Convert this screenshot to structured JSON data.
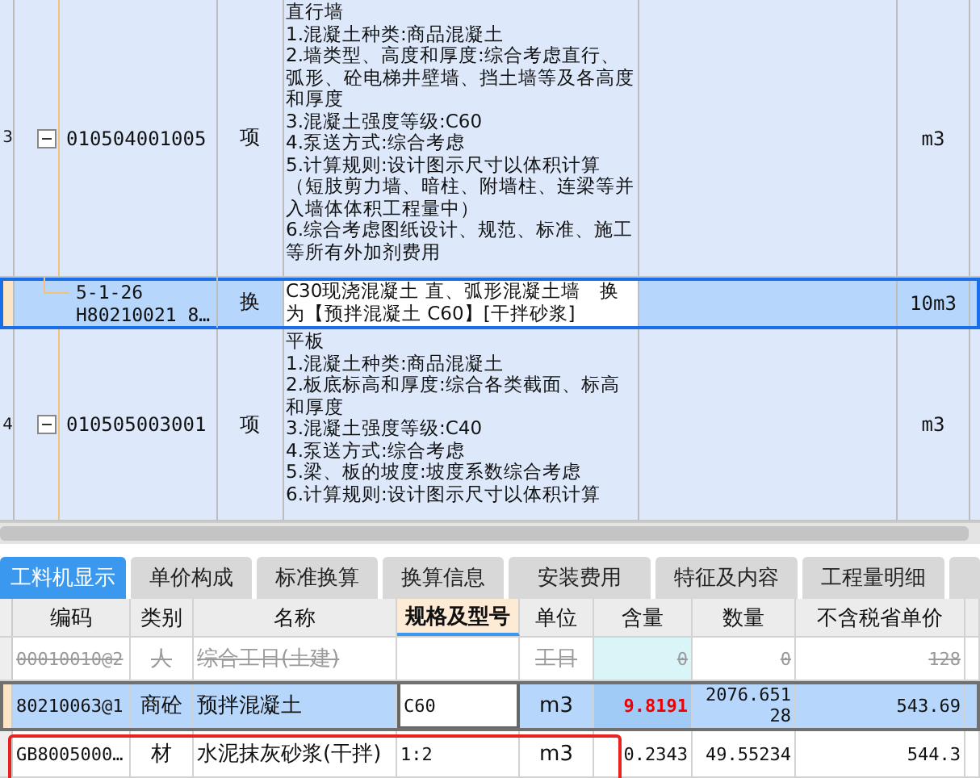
{
  "upper_table": {
    "rows": [
      {
        "kind": "item",
        "row_number": "3",
        "code": [
          "010504001005"
        ],
        "expanded": true,
        "selected": false,
        "type": "项",
        "description": [
          "直行墙",
          "1.混凝土种类:商品混凝土",
          "2.墙类型、高度和厚度:综合考虑直行、弧形、砼电梯井壁墙、挡土墙等及各高度和厚度",
          "3.混凝土强度等级:C60",
          "4.泵送方式:综合考虑",
          "5.计算规则:设计图示尺寸以体积计算（短肢剪力墙、暗柱、附墙柱、连梁等并入墙体体积工程量中）",
          "6.综合考虑图纸设计、规范、标准、施工等所有外加剂费用"
        ],
        "unit": "m3"
      },
      {
        "kind": "sub",
        "code": [
          "5-1-26",
          "H80210021 8…"
        ],
        "selected": true,
        "type": "换",
        "description": [
          "C30现浇混凝土 直、弧形混凝土墙　换为【预拌混凝土 C60】[干拌砂浆]"
        ],
        "unit": "10m3"
      },
      {
        "kind": "item",
        "row_number": "4",
        "code": [
          "010505003001"
        ],
        "expanded": true,
        "selected": false,
        "type": "项",
        "description": [
          "平板",
          "1.混凝土种类:商品混凝土",
          "2.板底标高和厚度:综合各类截面、标高和厚度",
          "3.混凝土强度等级:C40",
          "4.泵送方式:综合考虑",
          "5.梁、板的坡度:坡度系数综合考虑",
          "6.计算规则:设计图示尺寸以体积计算"
        ],
        "unit": "m3"
      }
    ]
  },
  "tabs": [
    {
      "label": "工料机显示",
      "selected": true
    },
    {
      "label": "单价构成",
      "selected": false
    },
    {
      "label": "标准换算",
      "selected": false
    },
    {
      "label": "换算信息",
      "selected": false
    },
    {
      "label": "安装费用",
      "selected": false
    },
    {
      "label": "特征及内容",
      "selected": false
    },
    {
      "label": "工程量明细",
      "selected": false
    }
  ],
  "resource_table": {
    "columns": [
      {
        "label": "编码",
        "selected": false
      },
      {
        "label": "类别",
        "selected": false
      },
      {
        "label": "名称",
        "selected": false
      },
      {
        "label": "规格及型号",
        "selected": true
      },
      {
        "label": "单位",
        "selected": false
      },
      {
        "label": "含量",
        "selected": false
      },
      {
        "label": "数量",
        "selected": false
      },
      {
        "label": "不含税省单价",
        "selected": false
      }
    ],
    "rows": [
      {
        "cells": [
          "00010010@2",
          "人",
          "综合工日(土建)",
          "",
          "工日",
          "0",
          "0",
          "128"
        ],
        "deleted": true,
        "selected": false,
        "modified": false,
        "highlighted": false
      },
      {
        "cells": [
          "80210063@1",
          "商砼",
          "预拌混凝土",
          "C60",
          "m3",
          "9.8191",
          "2076.65128",
          "543.69"
        ],
        "deleted": false,
        "selected": true,
        "modified": true,
        "highlighted": false
      },
      {
        "cells": [
          "GB8005000…",
          "材",
          "水泥抹灰砂浆(干拌)",
          "1:2",
          "m3",
          "0.2343",
          "49.55234",
          "544.3"
        ],
        "deleted": false,
        "selected": false,
        "modified": false,
        "highlighted": true
      }
    ]
  }
}
